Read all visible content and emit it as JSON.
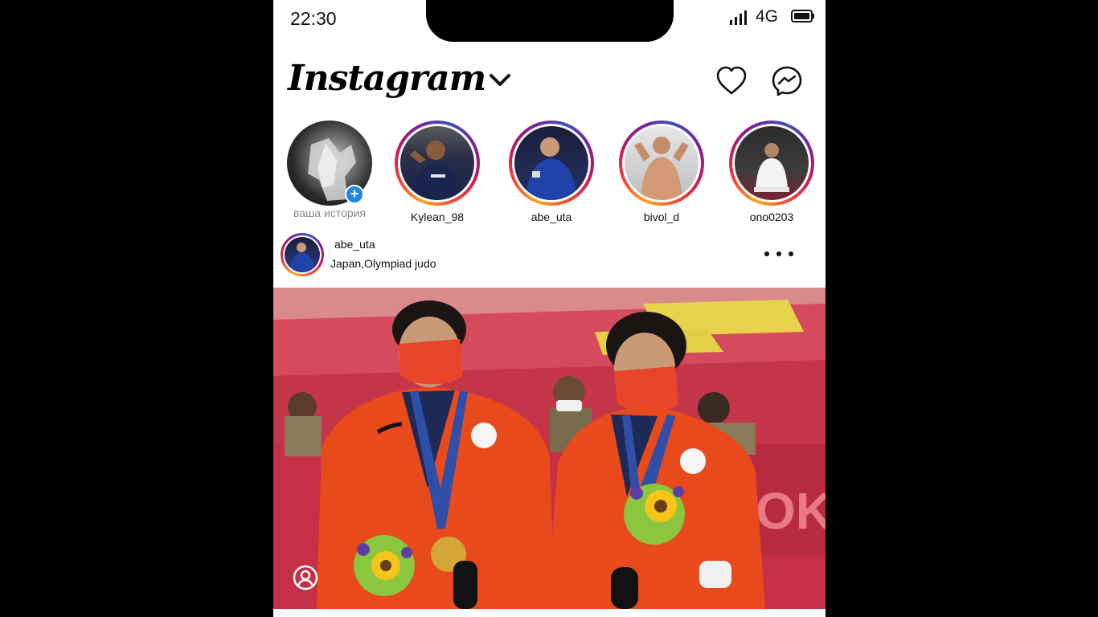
{
  "status_bar": {
    "time": "22:30",
    "network": "4G"
  },
  "header": {
    "logo": "Instagram"
  },
  "stories": [
    {
      "label": "ваша история",
      "own": true
    },
    {
      "label": "Kylean_98"
    },
    {
      "label": "abe_uta"
    },
    {
      "label": "bivol_d"
    },
    {
      "label": "ono0203"
    }
  ],
  "post": {
    "username": "abe_uta",
    "location": "Japan,Olympiad judo"
  },
  "icons": {
    "heart": "heart-icon",
    "messenger": "messenger-icon",
    "more": "more-options-icon",
    "profile": "profile-icon"
  }
}
